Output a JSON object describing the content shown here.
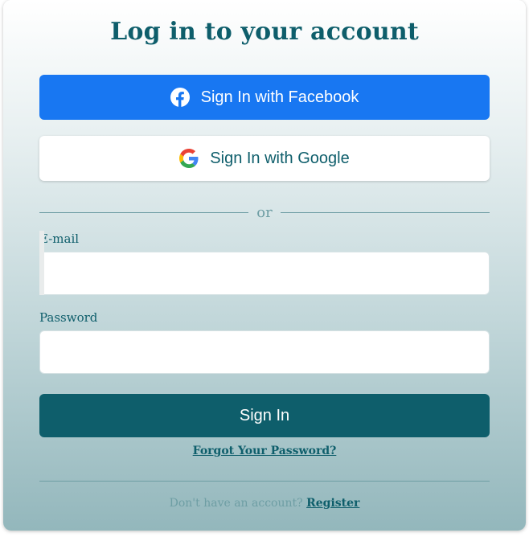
{
  "title": "Log in to your account",
  "social": {
    "facebook_label": "Sign In with Facebook",
    "google_label": "Sign In with Google"
  },
  "divider_text": "or",
  "form": {
    "email_label": "E-mail",
    "email_value": "",
    "password_label": "Password",
    "password_value": "",
    "submit_label": "Sign In"
  },
  "forgot_label": "Forgot Your Password?",
  "footer": {
    "prompt": "Don't have an account?",
    "register_label": "Register"
  },
  "colors": {
    "brand_teal": "#0e5e6b",
    "facebook_blue": "#1877f2",
    "muted_teal": "#6e9ea4"
  },
  "icons": [
    "facebook-icon",
    "google-icon"
  ]
}
